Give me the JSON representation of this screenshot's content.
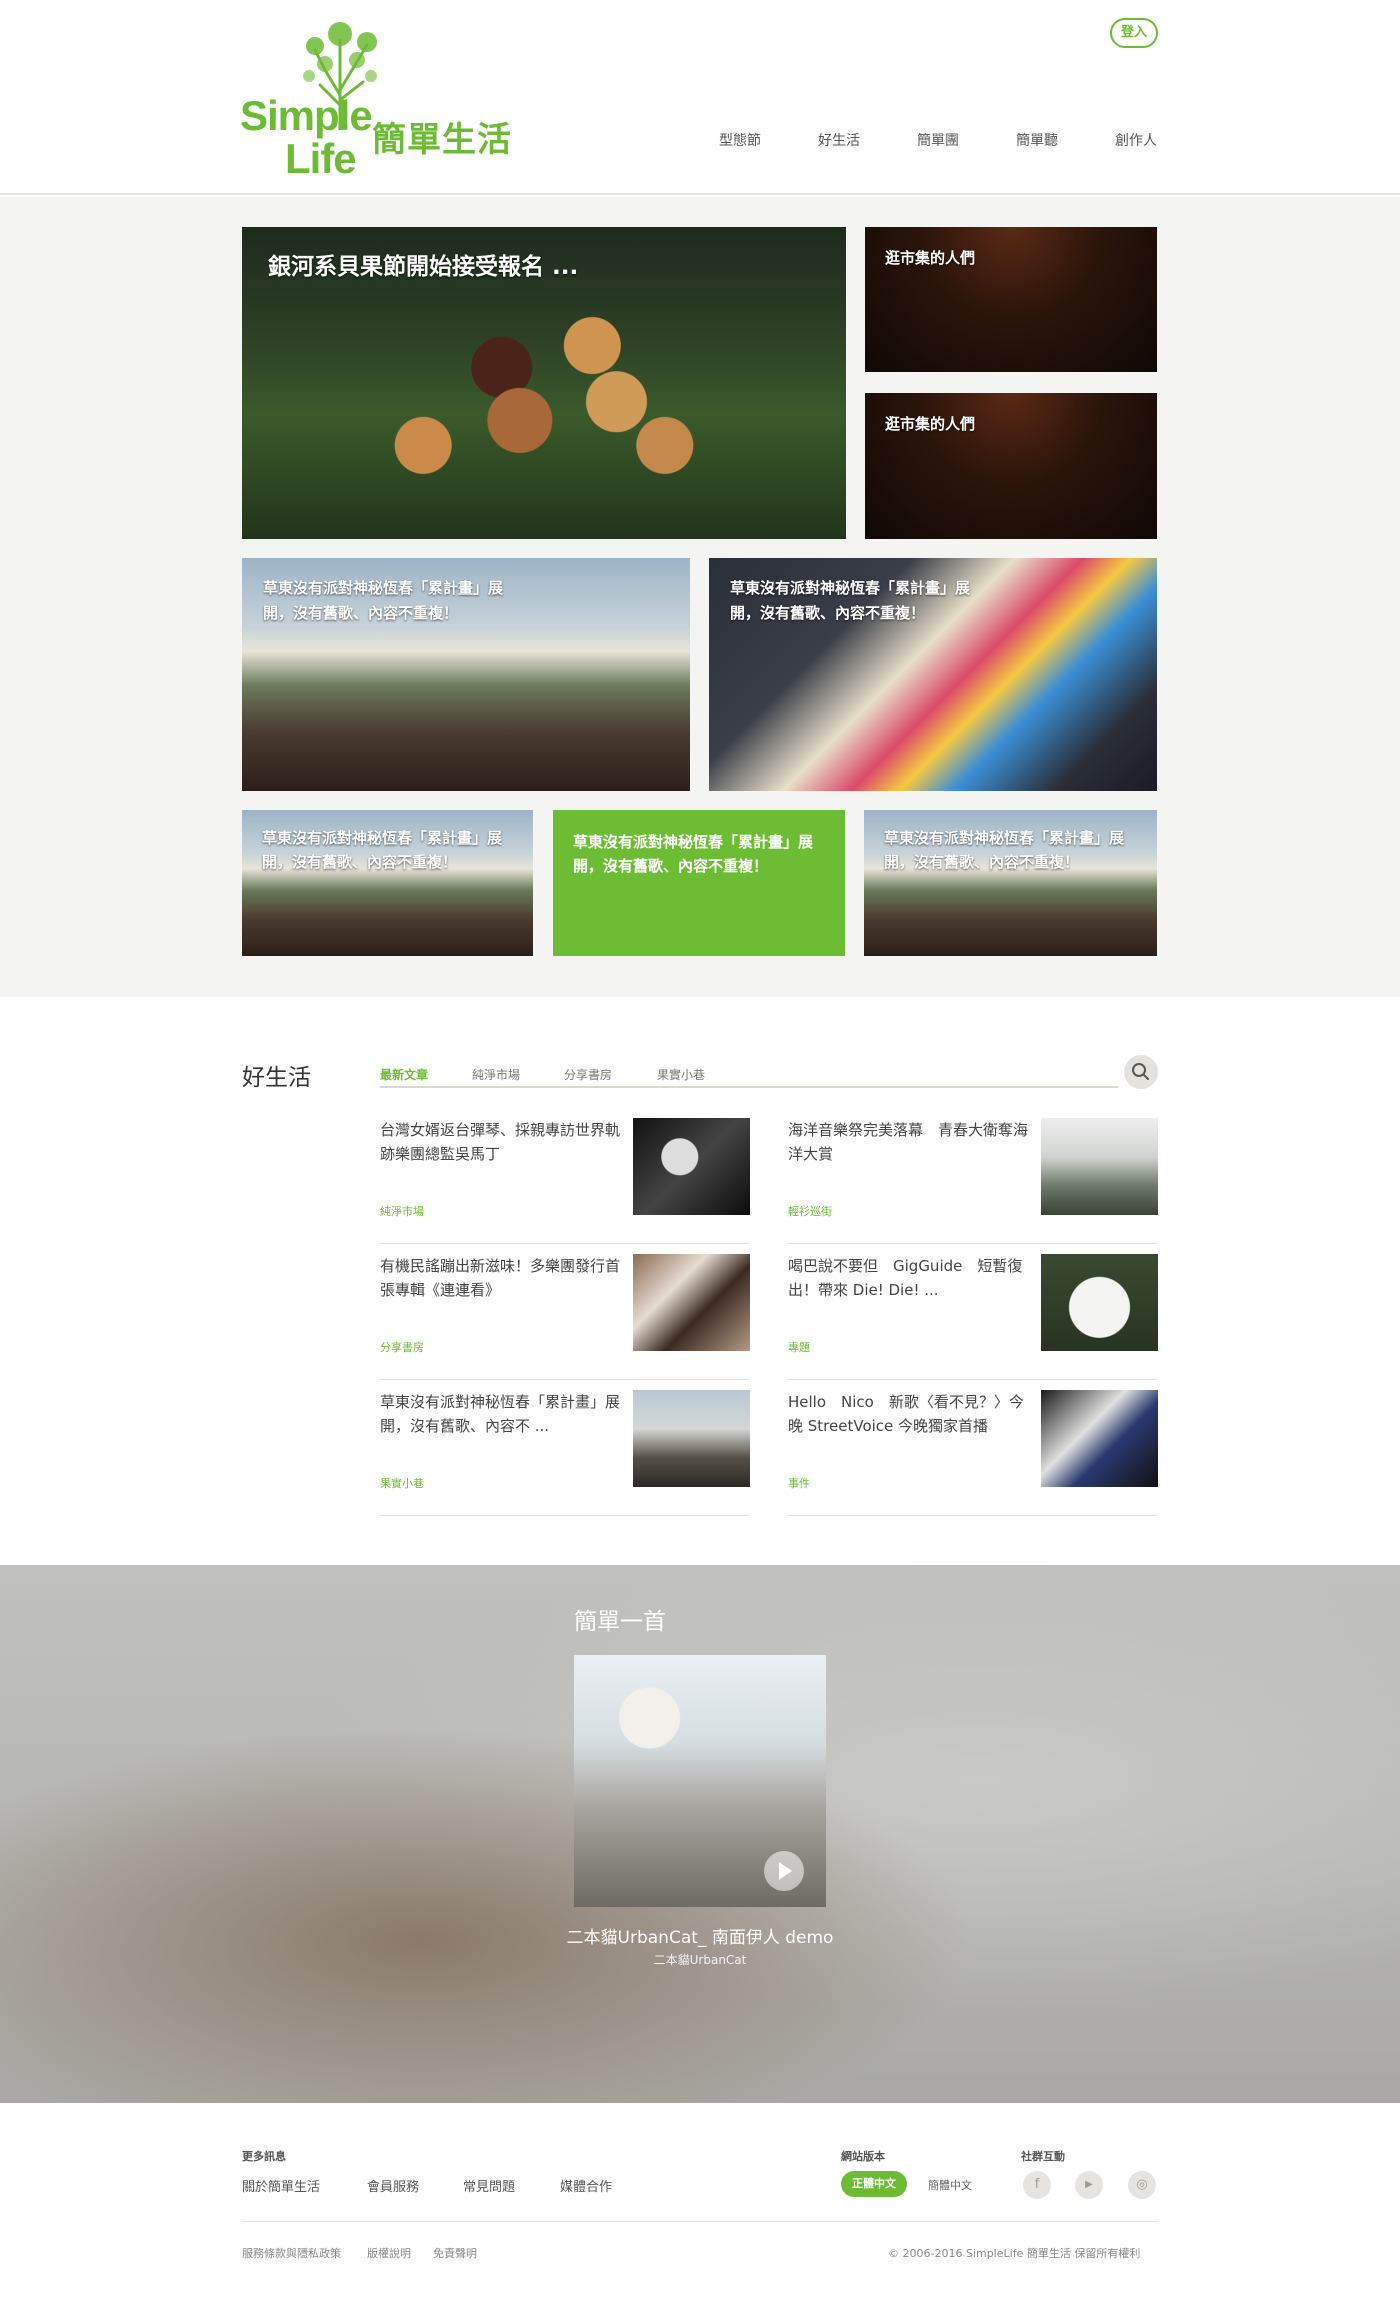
{
  "brand": {
    "logo_word1": "Simple",
    "logo_word2": "Life",
    "logo_cn": "簡單生活",
    "accent": "#6dbb35"
  },
  "header": {
    "login_label": "登入",
    "nav": [
      "型態節",
      "好生活",
      "簡單團",
      "簡單聽",
      "創作人"
    ]
  },
  "featured": {
    "main_title": "銀河系貝果節開始接受報名 ...",
    "side_items": [
      "逛市集的人們",
      "逛市集的人們"
    ],
    "mid_items": [
      "草東沒有派對神秘恆春「累計畫」展開，沒有舊歌、內容不重複！",
      "草東沒有派對神秘恆春「累計畫」展開，沒有舊歌、內容不重複！"
    ],
    "bottom_items": [
      "草東沒有派對神秘恆春「累計畫」展開，沒有舊歌、內容不重複！",
      "草東沒有派對神秘恆春「累計畫」展開，沒有舊歌、內容不重複！",
      "草東沒有派對神秘恆春「累計畫」展開，沒有舊歌、內容不重複！"
    ]
  },
  "goodlife": {
    "title": "好生活",
    "tabs": [
      "最新文章",
      "純淨市場",
      "分享書房",
      "果實小巷"
    ],
    "articles": [
      {
        "text": "台灣女婿返台彈琴、採親專訪世界軌跡樂團總監吳馬丁",
        "category": "純淨市場"
      },
      {
        "text": "海洋音樂祭完美落幕　青春大衛奪海洋大賞",
        "category": "輕衫巡街"
      },
      {
        "text": "有機民謠蹦出新滋味！多樂團發行首張專輯《連連看》",
        "category": "分享書房"
      },
      {
        "text": "喝巴說不要但　GigGuide　短暫復出！帶來 Die! Die! ...",
        "category": "專題"
      },
      {
        "text": "草東沒有派對神秘恆春「累計畫」展開，沒有舊歌、內容不 ...",
        "category": "果實小巷"
      },
      {
        "text": "Hello　Nico　新歌〈看不見？〉今晚 StreetVoice 今晚獨家首播",
        "category": "事件"
      }
    ]
  },
  "song": {
    "section_title": "簡單一首",
    "name": "二本貓UrbanCat_ 南面伊人 demo",
    "artist": "二本貓UrbanCat"
  },
  "footer": {
    "more_info": "更多訊息",
    "links": [
      "關於簡單生活",
      "會員服務",
      "常見問題",
      "媒體合作"
    ],
    "version_head": "網站版本",
    "lang_active": "正體中文",
    "lang_other": "簡體中文",
    "social_head": "社群互動",
    "social_icons": [
      "f",
      "▶",
      "◎"
    ],
    "bottom_links": [
      "服務條款與隱私政策",
      "版權說明",
      "免責聲明"
    ],
    "copyright": "© 2006-2016 SimpleLife 簡單生活 保留所有權利"
  }
}
